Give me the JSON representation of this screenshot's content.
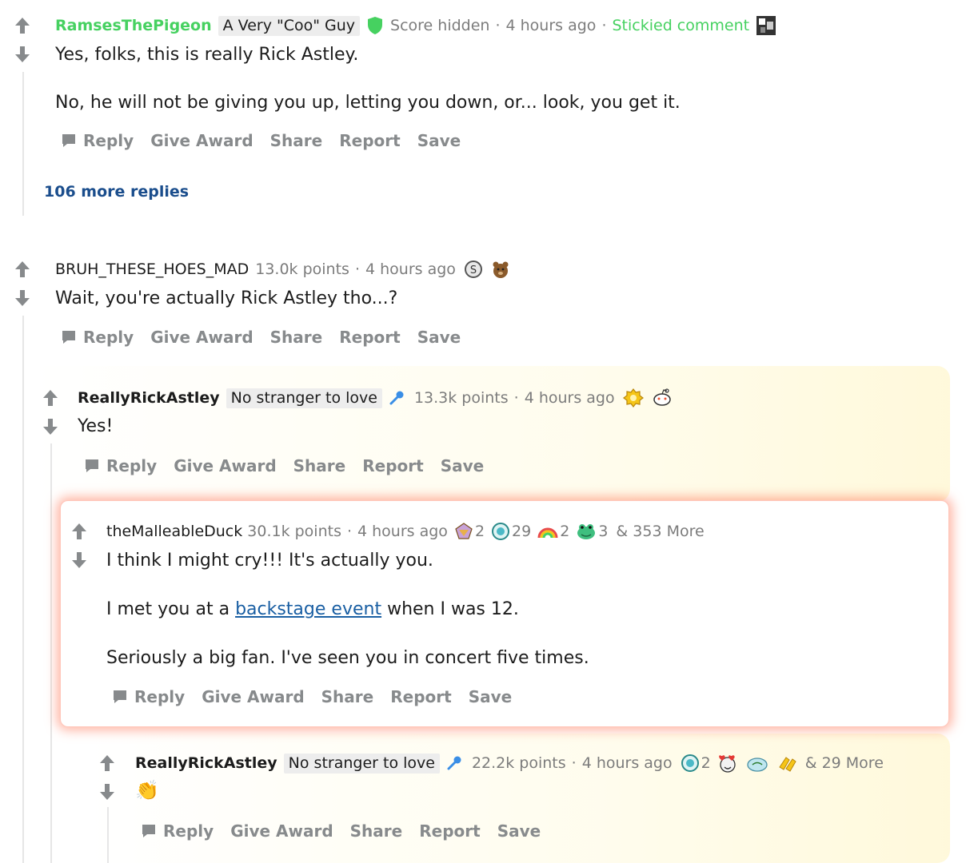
{
  "comments": [
    {
      "user": "RamsesThePigeon",
      "flair": "A Very \"Coo\" Guy",
      "score": "Score hidden",
      "time": "4 hours ago",
      "sticky": "Stickied comment",
      "body": [
        "Yes, folks, this is really Rick Astley.",
        "No, he will not be giving you up, letting you down, or... look, you get it."
      ],
      "more_replies": "106 more replies"
    },
    {
      "user": "BRUH_THESE_HOES_MAD",
      "score": "13.0k points",
      "time": "4 hours ago",
      "body": [
        "Wait, you're actually Rick Astley tho...?"
      ]
    },
    {
      "user": "ReallyRickAstley",
      "flair": "No stranger to love",
      "score": "13.3k points",
      "time": "4 hours ago",
      "body": [
        "Yes!"
      ]
    },
    {
      "user": "theMalleableDuck",
      "score": "30.1k points",
      "time": "4 hours ago",
      "award_counts": [
        "2",
        "29",
        "2",
        "3"
      ],
      "more_awards": "& 353 More",
      "body_1": "I think I might cry!!! It's actually you.",
      "body_2_before": "I met you at a ",
      "body_2_link": "backstage event",
      "body_2_after": " when I was 12.",
      "body_3": "Seriously a big fan. I've seen you in concert five times."
    },
    {
      "user": "ReallyRickAstley",
      "flair": "No stranger to love",
      "score": "22.2k points",
      "time": "4 hours ago",
      "award_counts": [
        "2"
      ],
      "more_awards": "& 29 More",
      "body": [
        "👏"
      ]
    }
  ],
  "actions": {
    "reply": "Reply",
    "give_award": "Give Award",
    "share": "Share",
    "report": "Report",
    "save": "Save"
  },
  "separator": "·",
  "colors": {
    "op_green": "#46d160",
    "link_blue": "#1a5fa3",
    "muted": "#878a8c"
  }
}
